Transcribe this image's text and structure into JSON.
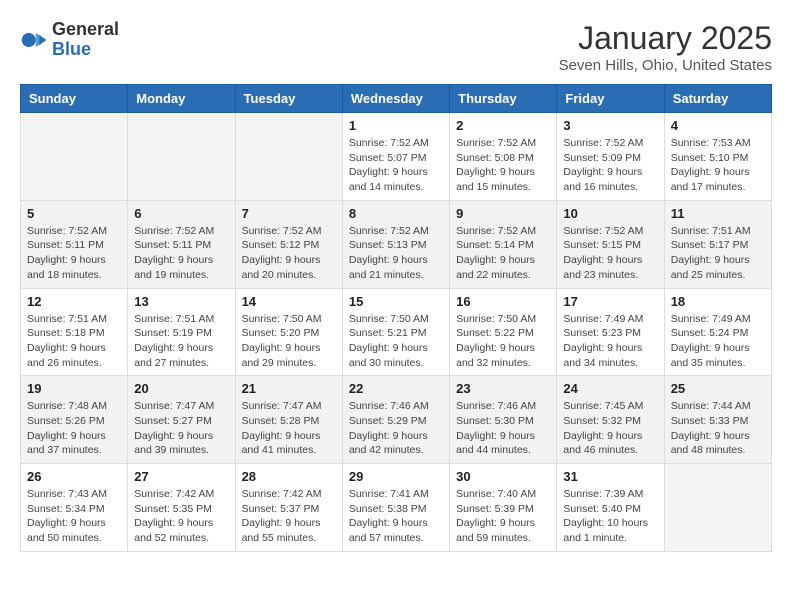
{
  "header": {
    "logo_general": "General",
    "logo_blue": "Blue",
    "month_title": "January 2025",
    "location": "Seven Hills, Ohio, United States"
  },
  "weekdays": [
    "Sunday",
    "Monday",
    "Tuesday",
    "Wednesday",
    "Thursday",
    "Friday",
    "Saturday"
  ],
  "weeks": [
    [
      {
        "day": "",
        "info": ""
      },
      {
        "day": "",
        "info": ""
      },
      {
        "day": "",
        "info": ""
      },
      {
        "day": "1",
        "info": "Sunrise: 7:52 AM\nSunset: 5:07 PM\nDaylight: 9 hours\nand 14 minutes."
      },
      {
        "day": "2",
        "info": "Sunrise: 7:52 AM\nSunset: 5:08 PM\nDaylight: 9 hours\nand 15 minutes."
      },
      {
        "day": "3",
        "info": "Sunrise: 7:52 AM\nSunset: 5:09 PM\nDaylight: 9 hours\nand 16 minutes."
      },
      {
        "day": "4",
        "info": "Sunrise: 7:53 AM\nSunset: 5:10 PM\nDaylight: 9 hours\nand 17 minutes."
      }
    ],
    [
      {
        "day": "5",
        "info": "Sunrise: 7:52 AM\nSunset: 5:11 PM\nDaylight: 9 hours\nand 18 minutes."
      },
      {
        "day": "6",
        "info": "Sunrise: 7:52 AM\nSunset: 5:11 PM\nDaylight: 9 hours\nand 19 minutes."
      },
      {
        "day": "7",
        "info": "Sunrise: 7:52 AM\nSunset: 5:12 PM\nDaylight: 9 hours\nand 20 minutes."
      },
      {
        "day": "8",
        "info": "Sunrise: 7:52 AM\nSunset: 5:13 PM\nDaylight: 9 hours\nand 21 minutes."
      },
      {
        "day": "9",
        "info": "Sunrise: 7:52 AM\nSunset: 5:14 PM\nDaylight: 9 hours\nand 22 minutes."
      },
      {
        "day": "10",
        "info": "Sunrise: 7:52 AM\nSunset: 5:15 PM\nDaylight: 9 hours\nand 23 minutes."
      },
      {
        "day": "11",
        "info": "Sunrise: 7:51 AM\nSunset: 5:17 PM\nDaylight: 9 hours\nand 25 minutes."
      }
    ],
    [
      {
        "day": "12",
        "info": "Sunrise: 7:51 AM\nSunset: 5:18 PM\nDaylight: 9 hours\nand 26 minutes."
      },
      {
        "day": "13",
        "info": "Sunrise: 7:51 AM\nSunset: 5:19 PM\nDaylight: 9 hours\nand 27 minutes."
      },
      {
        "day": "14",
        "info": "Sunrise: 7:50 AM\nSunset: 5:20 PM\nDaylight: 9 hours\nand 29 minutes."
      },
      {
        "day": "15",
        "info": "Sunrise: 7:50 AM\nSunset: 5:21 PM\nDaylight: 9 hours\nand 30 minutes."
      },
      {
        "day": "16",
        "info": "Sunrise: 7:50 AM\nSunset: 5:22 PM\nDaylight: 9 hours\nand 32 minutes."
      },
      {
        "day": "17",
        "info": "Sunrise: 7:49 AM\nSunset: 5:23 PM\nDaylight: 9 hours\nand 34 minutes."
      },
      {
        "day": "18",
        "info": "Sunrise: 7:49 AM\nSunset: 5:24 PM\nDaylight: 9 hours\nand 35 minutes."
      }
    ],
    [
      {
        "day": "19",
        "info": "Sunrise: 7:48 AM\nSunset: 5:26 PM\nDaylight: 9 hours\nand 37 minutes."
      },
      {
        "day": "20",
        "info": "Sunrise: 7:47 AM\nSunset: 5:27 PM\nDaylight: 9 hours\nand 39 minutes."
      },
      {
        "day": "21",
        "info": "Sunrise: 7:47 AM\nSunset: 5:28 PM\nDaylight: 9 hours\nand 41 minutes."
      },
      {
        "day": "22",
        "info": "Sunrise: 7:46 AM\nSunset: 5:29 PM\nDaylight: 9 hours\nand 42 minutes."
      },
      {
        "day": "23",
        "info": "Sunrise: 7:46 AM\nSunset: 5:30 PM\nDaylight: 9 hours\nand 44 minutes."
      },
      {
        "day": "24",
        "info": "Sunrise: 7:45 AM\nSunset: 5:32 PM\nDaylight: 9 hours\nand 46 minutes."
      },
      {
        "day": "25",
        "info": "Sunrise: 7:44 AM\nSunset: 5:33 PM\nDaylight: 9 hours\nand 48 minutes."
      }
    ],
    [
      {
        "day": "26",
        "info": "Sunrise: 7:43 AM\nSunset: 5:34 PM\nDaylight: 9 hours\nand 50 minutes."
      },
      {
        "day": "27",
        "info": "Sunrise: 7:42 AM\nSunset: 5:35 PM\nDaylight: 9 hours\nand 52 minutes."
      },
      {
        "day": "28",
        "info": "Sunrise: 7:42 AM\nSunset: 5:37 PM\nDaylight: 9 hours\nand 55 minutes."
      },
      {
        "day": "29",
        "info": "Sunrise: 7:41 AM\nSunset: 5:38 PM\nDaylight: 9 hours\nand 57 minutes."
      },
      {
        "day": "30",
        "info": "Sunrise: 7:40 AM\nSunset: 5:39 PM\nDaylight: 9 hours\nand 59 minutes."
      },
      {
        "day": "31",
        "info": "Sunrise: 7:39 AM\nSunset: 5:40 PM\nDaylight: 10 hours\nand 1 minute."
      },
      {
        "day": "",
        "info": ""
      }
    ]
  ]
}
